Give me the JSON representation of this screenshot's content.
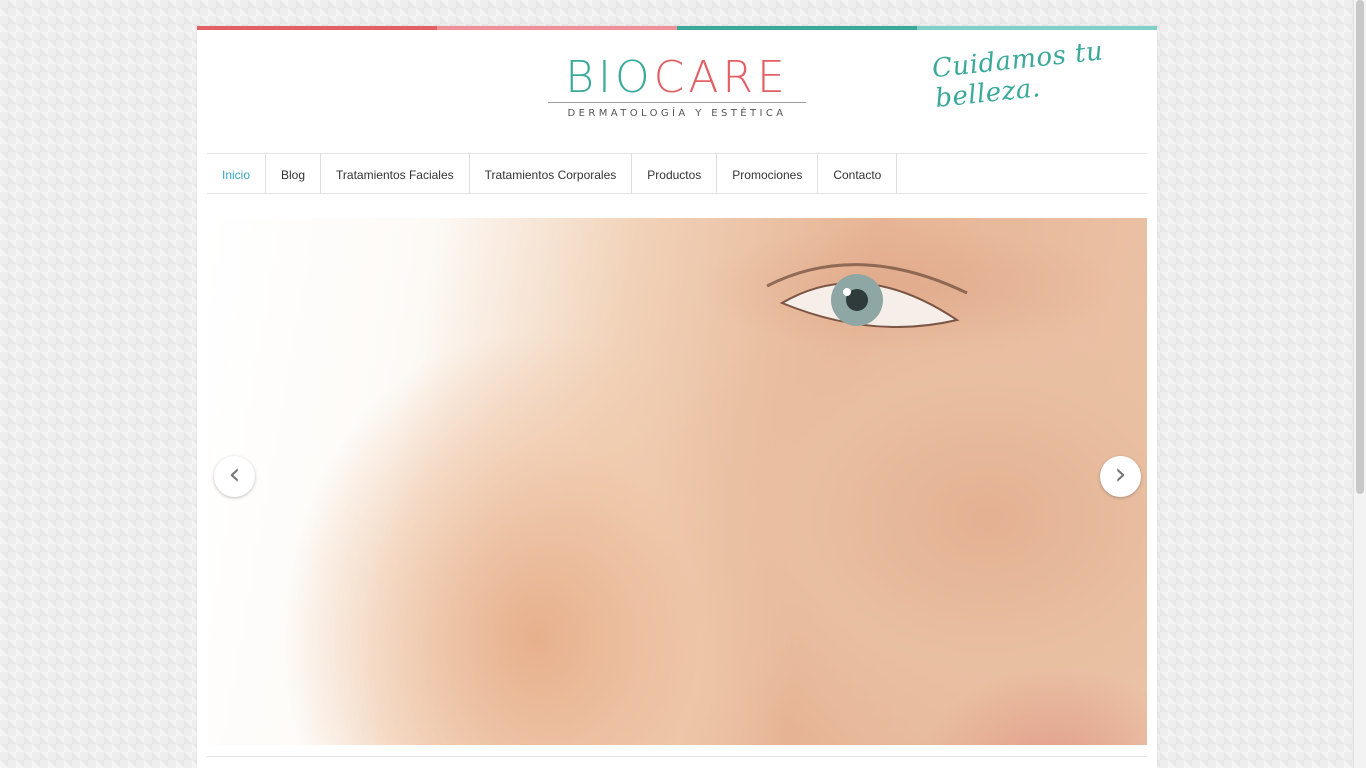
{
  "brand": {
    "word_part1": "BIO",
    "word_part2": "CARE",
    "subtitle": "DERMATOLOGÍA Y ESTÉTICA",
    "tagline": "Cuidamos tu belleza.",
    "colors": {
      "teal": "#3aa99a",
      "coral": "#e35f66",
      "light_teal": "#7fd0c8",
      "pink": "#ee9198"
    }
  },
  "nav": {
    "items": [
      {
        "label": "Inicio",
        "active": true
      },
      {
        "label": "Blog"
      },
      {
        "label": "Tratamientos Faciales"
      },
      {
        "label": "Tratamientos Corporales"
      },
      {
        "label": "Productos"
      },
      {
        "label": "Promociones"
      },
      {
        "label": "Contacto"
      }
    ]
  },
  "slider": {
    "prev_icon": "‹",
    "next_icon": "›",
    "image": "close-up of woman's face with freckled skin"
  }
}
